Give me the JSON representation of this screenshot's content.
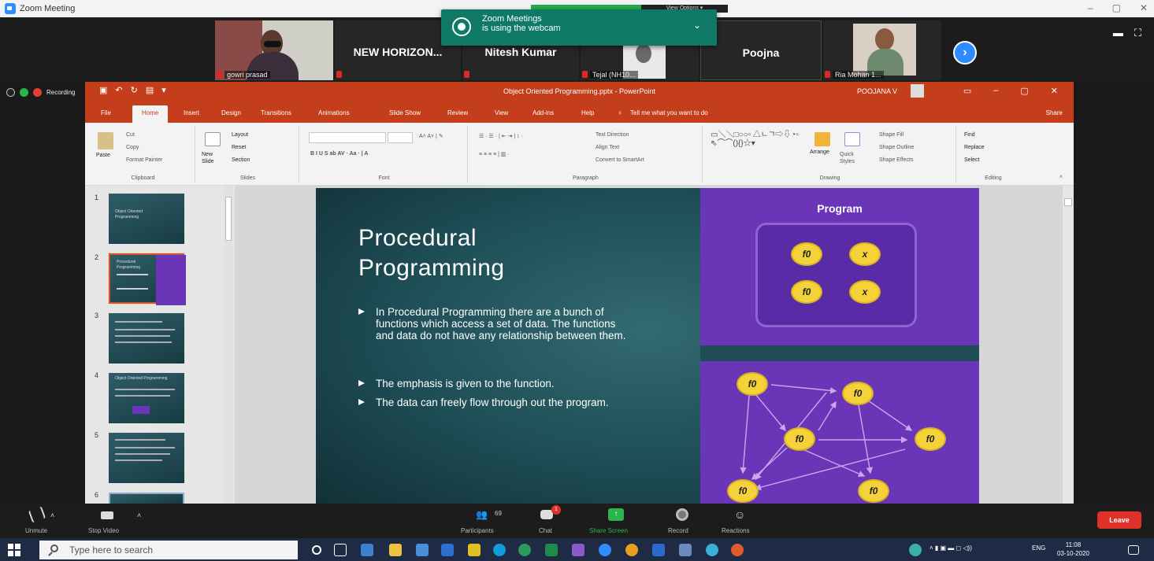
{
  "window": {
    "title": "Zoom Meeting",
    "controls": [
      "–",
      "▢",
      "✕"
    ]
  },
  "participants": [
    {
      "name": "gowri prasad",
      "has_video": true
    },
    {
      "name": "NEW HORIZON...",
      "has_video": false
    },
    {
      "name": "Nitesh Kumar",
      "has_video": false
    },
    {
      "name": "Tejal (NH10...",
      "has_video": true
    },
    {
      "name": "Poojna",
      "has_video": false
    },
    {
      "name": "Ria Mohan 1...",
      "has_video": true
    }
  ],
  "notification": {
    "line1": "Zoom Meetings",
    "line2": "is using the webcam"
  },
  "share_banner": {
    "view_options": "View Options ▾"
  },
  "recording": {
    "label": "Recording"
  },
  "powerpoint": {
    "title": "Object Oriented Programming.pptx - PowerPoint",
    "user": "POOJANA V",
    "tabs": [
      "File",
      "Home",
      "Insert",
      "Design",
      "Transitions",
      "Animations",
      "Slide Show",
      "Review",
      "View",
      "Add-ins",
      "Help",
      "Tell me what you want to do"
    ],
    "active_tab": "Home",
    "share": "Share",
    "clipboard": {
      "paste": "Paste",
      "cut": "Cut",
      "copy": "Copy",
      "format_painter": "Format Painter",
      "label": "Clipboard"
    },
    "slides_group": {
      "new_slide": "New Slide",
      "layout": "Layout",
      "reset": "Reset",
      "section": "Section",
      "label": "Slides"
    },
    "font_group": {
      "label": "Font"
    },
    "paragraph_group": {
      "text_direction": "Text Direction",
      "align_text": "Align Text",
      "smartart": "Convert to SmartArt",
      "label": "Paragraph"
    },
    "drawing_group": {
      "arrange": "Arrange",
      "quick_styles": "Quick Styles",
      "shape_fill": "Shape Fill",
      "shape_outline": "Shape Outline",
      "shape_effects": "Shape Effects",
      "label": "Drawing"
    },
    "editing_group": {
      "find": "Find",
      "replace": "Replace",
      "select": "Select",
      "label": "Editing"
    },
    "thumbnails": [
      {
        "num": "1",
        "text": "Object Oriented Programming"
      },
      {
        "num": "2",
        "text": "Procedural Programming",
        "selected": true
      },
      {
        "num": "3",
        "text": ""
      },
      {
        "num": "4",
        "text": "Object Oriented Programming"
      },
      {
        "num": "5",
        "text": ""
      },
      {
        "num": "6",
        "text": ""
      }
    ]
  },
  "slide": {
    "title": "Procedural\nProgramming",
    "bullets": [
      "In Procedural Programming there are a bunch of functions which access a set of data. The functions and data do not have any relationship between them.",
      "The emphasis is given to the function.",
      "The data can freely flow through out the program."
    ],
    "program_label": "Program",
    "box_coins": [
      "f0",
      "x",
      "f0",
      "x"
    ],
    "network_coin": "f0"
  },
  "toolbar": {
    "unmute": "Unmute",
    "stop_video": "Stop Video",
    "participants": "Participants",
    "participants_count": "69",
    "chat": "Chat",
    "chat_badge": "1",
    "share_screen": "Share Screen",
    "record": "Record",
    "reactions": "Reactions",
    "leave": "Leave"
  },
  "taskbar": {
    "search_placeholder": "Type here to search",
    "lang": "ENG",
    "time": "11:08",
    "date": "03-10-2020"
  },
  "colors": {
    "ppt_red": "#c43e1c",
    "zoom_blue": "#2d8cff",
    "notif_green": "#0e7a66",
    "slide_purple": "#6b35b8",
    "coin_yellow": "#f5d23a",
    "leave_red": "#e0302a"
  }
}
